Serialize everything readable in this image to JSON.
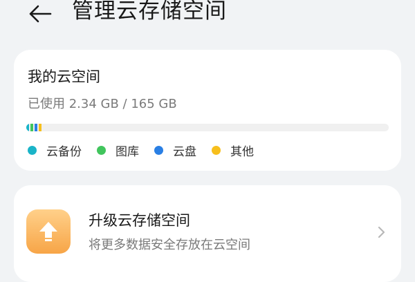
{
  "header": {
    "title": "管理云存储空间",
    "back_icon": "arrow-left-icon"
  },
  "storage": {
    "title": "我的云空间",
    "usage_text": "已使用 2.34 GB / 165 GB",
    "used_gb": 2.34,
    "total_gb": 165,
    "segments": [
      {
        "name": "云备份",
        "color": "#1ab4c8",
        "fraction": 0.006
      },
      {
        "name": "图库",
        "color": "#41c55d",
        "fraction": 0.002
      },
      {
        "name": "云盘",
        "color": "#2a7fe4",
        "fraction": 0.003
      },
      {
        "name": "其他",
        "color": "#f7bf1c",
        "fraction": 0.003
      }
    ],
    "legend": [
      {
        "label": "云备份",
        "color": "#1ab4c8"
      },
      {
        "label": "图库",
        "color": "#41c55d"
      },
      {
        "label": "云盘",
        "color": "#2a7fe4"
      },
      {
        "label": "其他",
        "color": "#f7bf1c"
      }
    ]
  },
  "upgrade": {
    "title": "升级云存储空间",
    "subtitle": "将更多数据安全存放在云空间",
    "icon": "upload-arrow-icon",
    "chevron_icon": "chevron-right-icon"
  }
}
